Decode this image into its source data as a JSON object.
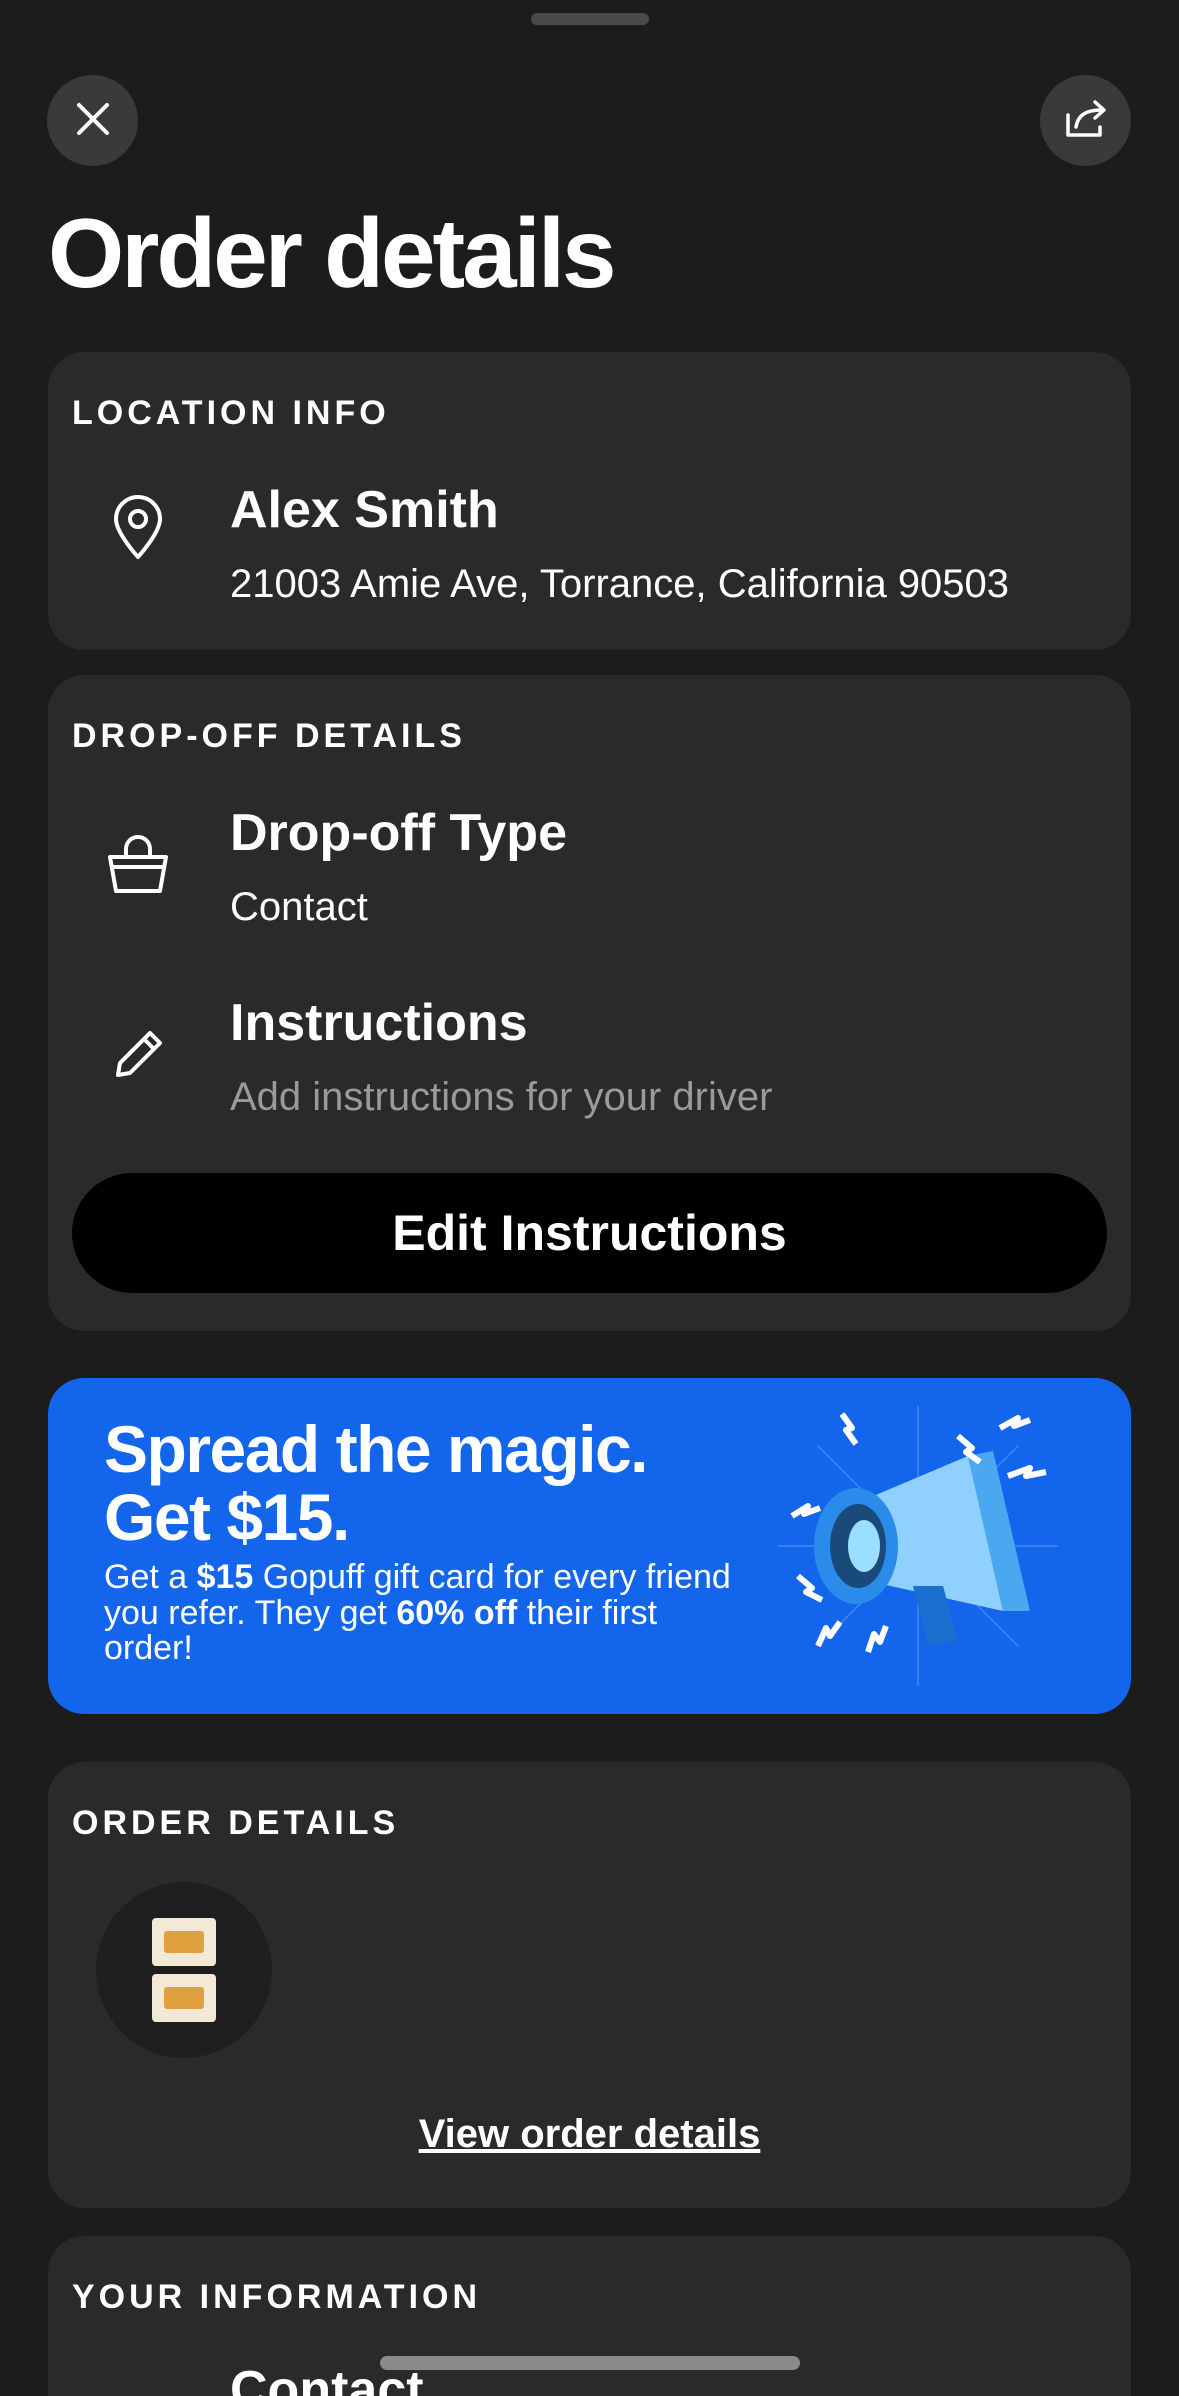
{
  "header": {
    "title": "Order details",
    "close_icon": "close-icon",
    "share_icon": "share-icon"
  },
  "location": {
    "heading": "LOCATION INFO",
    "name": "Alex Smith",
    "address": "21003 Amie Ave, Torrance, California 90503",
    "icon": "location-pin-icon"
  },
  "dropoff": {
    "heading": "DROP-OFF DETAILS",
    "type_label": "Drop-off Type",
    "type_value": "Contact",
    "instructions_label": "Instructions",
    "instructions_placeholder": "Add instructions for your driver",
    "edit_button": "Edit Instructions",
    "bag_icon": "shopping-bag-icon",
    "pencil_icon": "pencil-icon"
  },
  "promo": {
    "headline_1": "Spread the magic.",
    "headline_2": "Get $15.",
    "body_1": "Get a ",
    "body_amount": "$15",
    "body_2": " Gopuff gift card for every friend you refer. They get ",
    "body_discount": "60% off",
    "body_3": " their first order!",
    "background": "#1366ec",
    "art_icon": "megaphone-icon"
  },
  "order": {
    "heading": "ORDER DETAILS",
    "view_link": "View order details",
    "thumbnail_icon": "product-thumbnail"
  },
  "your_info": {
    "heading": "YOUR INFORMATION",
    "row_title": "Contact"
  },
  "colors": {
    "background": "#1c1c1c",
    "card": "#2a2a2a",
    "accent": "#1366ec",
    "muted_text": "#9a9a9a"
  }
}
